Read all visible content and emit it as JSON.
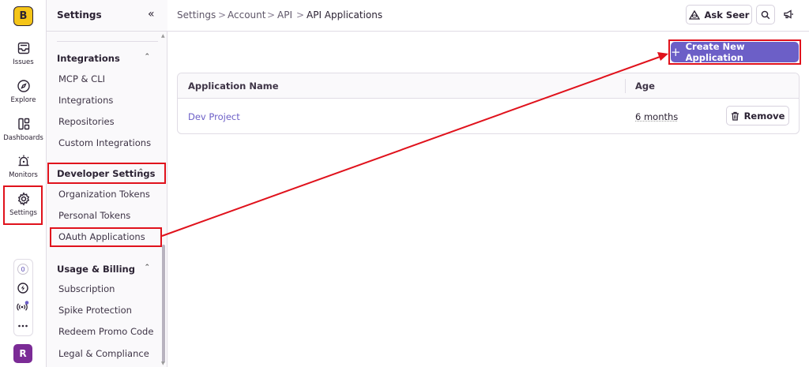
{
  "org": {
    "initial": "B"
  },
  "rail": {
    "items": [
      {
        "label": "Issues",
        "icon": "inbox-icon"
      },
      {
        "label": "Explore",
        "icon": "compass-icon"
      },
      {
        "label": "Dashboards",
        "icon": "dashboards-icon"
      },
      {
        "label": "Monitors",
        "icon": "siren-icon"
      },
      {
        "label": "Settings",
        "icon": "gear-icon"
      }
    ],
    "status_count": "0",
    "avatar_initial": "R"
  },
  "sidebar": {
    "title": "Settings",
    "collapse_glyph": "«",
    "sections": [
      {
        "title": "Integrations",
        "items": [
          "MCP & CLI",
          "Integrations",
          "Repositories",
          "Custom Integrations"
        ]
      },
      {
        "title": "Developer Settings",
        "items": [
          "Organization Tokens",
          "Personal Tokens",
          "OAuth Applications"
        ]
      },
      {
        "title": "Usage & Billing",
        "items": [
          "Subscription",
          "Spike Protection",
          "Redeem Promo Code",
          "Legal & Compliance"
        ]
      }
    ]
  },
  "breadcrumb": [
    "Settings",
    "Account",
    "API",
    "API Applications"
  ],
  "topbar": {
    "ask_label": "Ask Seer"
  },
  "main": {
    "create_label": "Create New Application",
    "columns": [
      "Application Name",
      "Age"
    ],
    "rows": [
      {
        "name": "Dev Project",
        "age": "6 months",
        "action": "Remove"
      }
    ]
  },
  "colors": {
    "accent": "#6c5fc7",
    "highlight": "#e0121c",
    "org_badge": "#f5c518",
    "avatar": "#7b2b96"
  }
}
